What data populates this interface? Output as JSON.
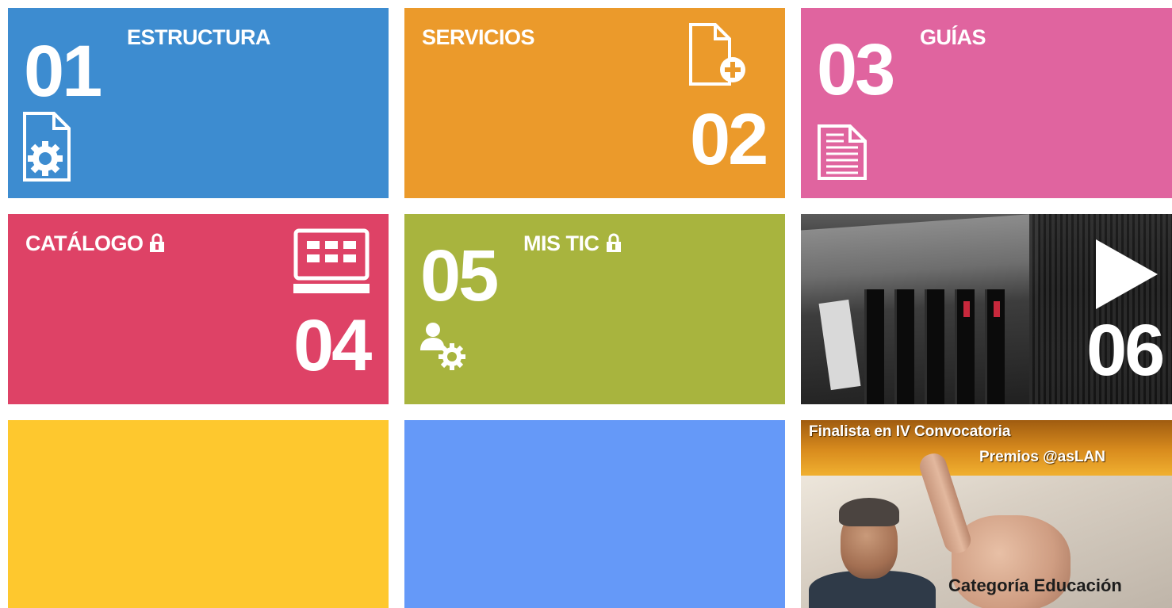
{
  "tiles": [
    {
      "label": "ESTRUCTURA",
      "number": "01",
      "icon": "document-gear-icon",
      "color": "#3d8cd0"
    },
    {
      "label": "SERVICIOS",
      "number": "02",
      "icon": "document-add-icon",
      "color": "#eb9a2b"
    },
    {
      "label": "GUÍAS",
      "number": "03",
      "icon": "document-text-icon",
      "color": "#e0649f"
    },
    {
      "label": "CATÁLOGO",
      "number": "04",
      "icon": "keypad-device-icon",
      "locked": true,
      "color": "#de4266"
    },
    {
      "label": "MIS TIC",
      "number": "05",
      "icon": "user-settings-icon",
      "locked": true,
      "color": "#a8b43e"
    },
    {
      "number": "06",
      "icon": "play-icon"
    },
    {
      "color": "#fec82e"
    },
    {
      "color": "#6599f8"
    }
  ],
  "award": {
    "line1": "Finalista en IV Convocatoria",
    "line2": "Premios @asLAN",
    "line3": "Categoría Educación"
  }
}
